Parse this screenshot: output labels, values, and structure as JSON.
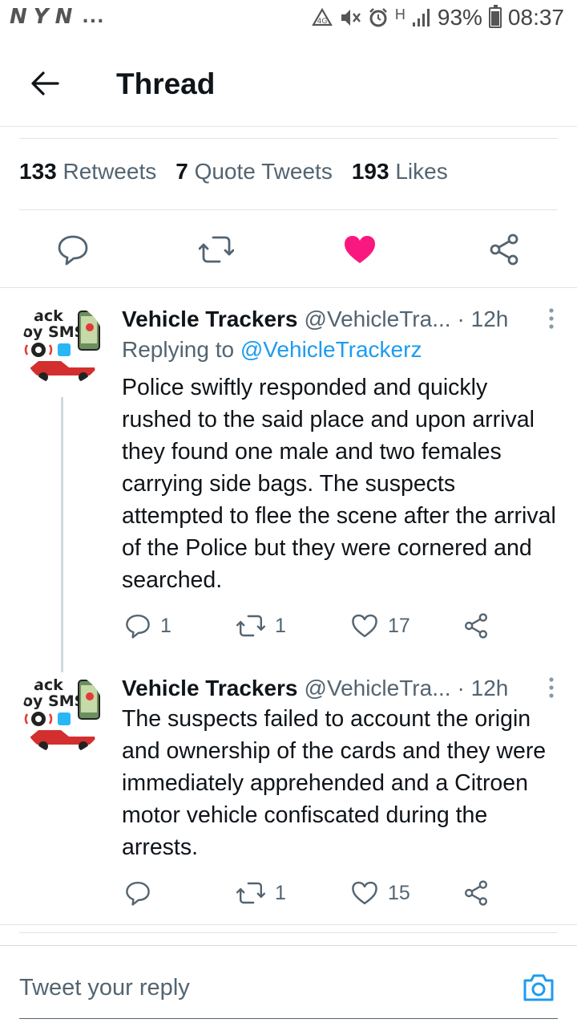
{
  "status_bar": {
    "left_icons": [
      "N",
      "Y",
      "N"
    ],
    "overflow": "...",
    "signal_label": "H",
    "battery": "93%",
    "time": "08:37"
  },
  "header": {
    "title": "Thread"
  },
  "stats": {
    "retweets_count": "133",
    "retweets_label": "Retweets",
    "quotes_count": "7",
    "quotes_label": "Quote Tweets",
    "likes_count": "193",
    "likes_label": "Likes"
  },
  "colors": {
    "accent": "#1d9bf0",
    "like": "#f91880",
    "text_primary": "#0f1419",
    "text_secondary": "#536471"
  },
  "tweets": [
    {
      "name": "Vehicle Trackers",
      "handle": "@VehicleTra...",
      "time": "· 12h",
      "reply_prefix": "Replying to",
      "reply_handle": "@VehicleTrackerz",
      "text": "Police swiftly responded and quickly rushed to the said place and upon arrival they found one male and two females carrying side bags. The suspects attempted to flee the scene after the arrival of the Police but they were cornered and searched.",
      "replies": "1",
      "retweets": "1",
      "likes": "17"
    },
    {
      "name": "Vehicle Trackers",
      "handle": "@VehicleTra...",
      "time": "· 12h",
      "text": "The suspects failed to account the origin and ownership of the cards and they were immediately apprehended and a Citroen motor vehicle confiscated during the arrests.",
      "replies": "",
      "retweets": "1",
      "likes": "15"
    }
  ],
  "avatar": {
    "line1": "ack",
    "line2": "oy SMS"
  },
  "reply_bar": {
    "placeholder": "Tweet your reply"
  }
}
